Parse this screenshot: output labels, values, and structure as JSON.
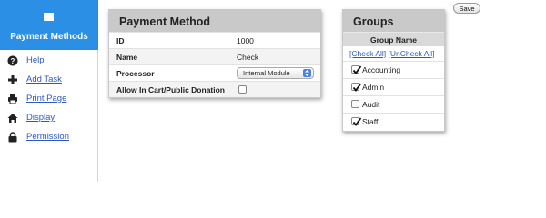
{
  "sidebar": {
    "title": "Payment Methods",
    "header_icon": "list-icon",
    "items": [
      {
        "label": "Help",
        "icon": "question-circle-icon"
      },
      {
        "label": "Add Task",
        "icon": "plus-icon"
      },
      {
        "label": "Print Page",
        "icon": "printer-icon"
      },
      {
        "label": "Display",
        "icon": "home-icon"
      },
      {
        "label": "Permission",
        "icon": "lock-icon"
      }
    ]
  },
  "payment_method": {
    "title": "Payment Method",
    "rows": {
      "id": {
        "label": "ID",
        "value": "1000"
      },
      "name": {
        "label": "Name",
        "value": "Check"
      },
      "processor": {
        "label": "Processor",
        "value": "Internal Module"
      },
      "allow": {
        "label": "Allow In Cart/Public Donation",
        "checked": false
      }
    }
  },
  "groups": {
    "title": "Groups",
    "column_header": "Group Name",
    "check_all": "[Check All]",
    "uncheck_all": "[UnCheck All]",
    "items": [
      {
        "label": "Accounting",
        "checked": true
      },
      {
        "label": "Admin",
        "checked": true
      },
      {
        "label": "Audit",
        "checked": false
      },
      {
        "label": "Staff",
        "checked": true
      }
    ]
  },
  "toolbar": {
    "save_label": "Save"
  },
  "colors": {
    "accent": "#2a8fe5",
    "link": "#2b59c3",
    "panel_header": "#c9c9c9"
  }
}
